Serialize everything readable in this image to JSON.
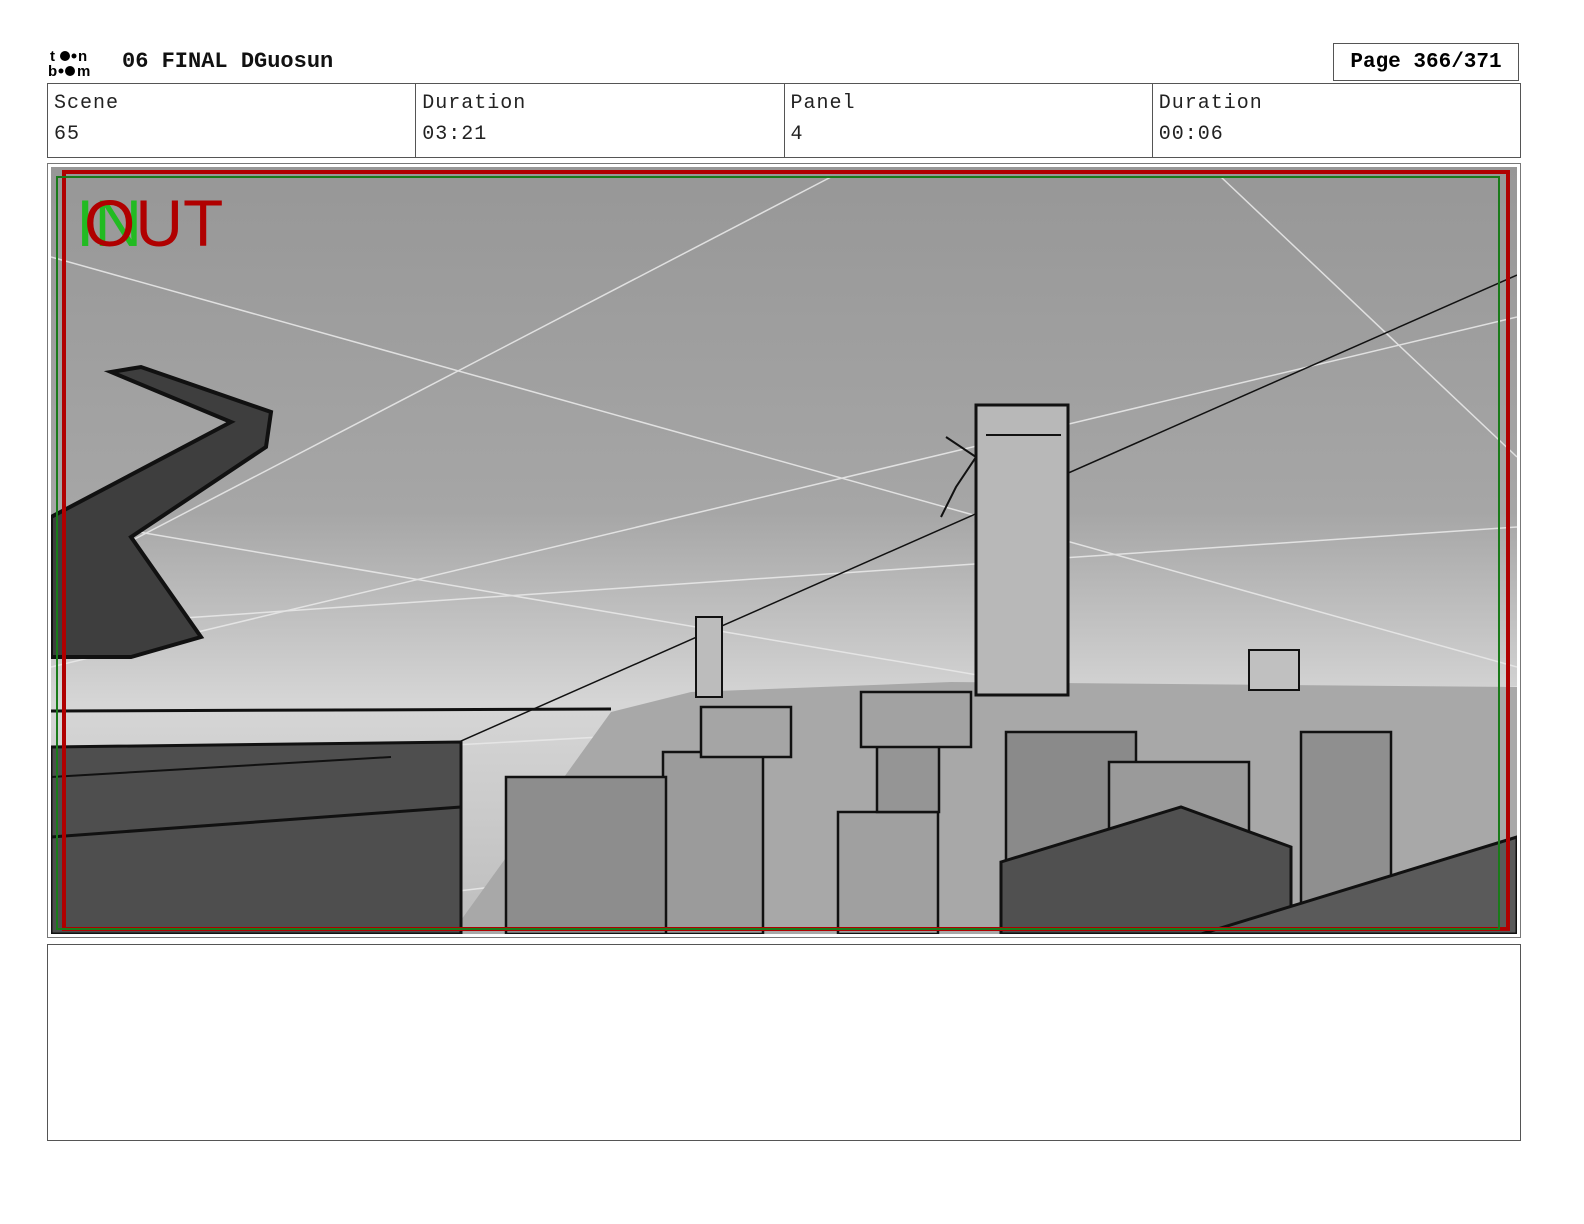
{
  "header": {
    "logo": "toon boom",
    "title": "06 FINAL DGuosun",
    "page": "Page 366/371"
  },
  "info": [
    {
      "label": "Scene",
      "value": "65"
    },
    {
      "label": "Duration",
      "value": "03:21"
    },
    {
      "label": "Panel",
      "value": "4"
    },
    {
      "label": "Duration",
      "value": "00:06"
    }
  ],
  "panel": {
    "in_label": "IN",
    "out_label": "OUT",
    "colors": {
      "safe_frame": "#b00000",
      "action_frame": "#1a8a1a"
    }
  },
  "notes": {}
}
